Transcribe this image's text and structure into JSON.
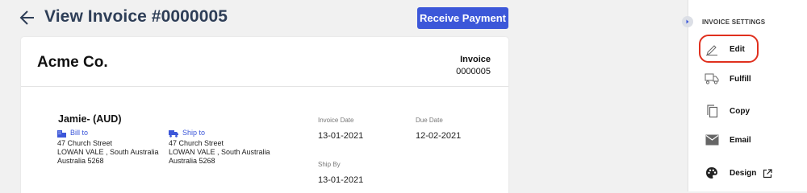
{
  "header": {
    "title": "View Invoice #0000005",
    "receive_payment_label": "Receive Payment"
  },
  "invoice": {
    "company_name": "Acme Co.",
    "invoice_label": "Invoice",
    "invoice_number": "0000005",
    "customer_name": "Jamie- (AUD)",
    "bill_to": {
      "label": "Bill to",
      "line1": "47 Church Street",
      "line2": "LOWAN VALE , South Australia",
      "line3": "Australia 5268"
    },
    "ship_to": {
      "label": "Ship to",
      "line1": "47 Church Street",
      "line2": "LOWAN VALE , South Australia",
      "line3": "Australia 5268"
    },
    "invoice_date_label": "Invoice Date",
    "invoice_date": "13-01-2021",
    "due_date_label": "Due Date",
    "due_date": "12-02-2021",
    "ship_by_label": "Ship By",
    "ship_by": "13-01-2021"
  },
  "settings": {
    "title": "INVOICE SETTINGS",
    "actions": [
      {
        "label": "Edit",
        "icon": "pencil-icon"
      },
      {
        "label": "Fulfill",
        "icon": "truck-icon"
      },
      {
        "label": "Copy",
        "icon": "copy-icon"
      },
      {
        "label": "Email",
        "icon": "envelope-icon"
      },
      {
        "label": "Design",
        "icon": "palette-icon",
        "external_icon": "open-external-icon"
      }
    ],
    "highlight_color": "#e0301e"
  },
  "colors": {
    "accent": "#3c57d9",
    "title": "#2e3e57"
  }
}
